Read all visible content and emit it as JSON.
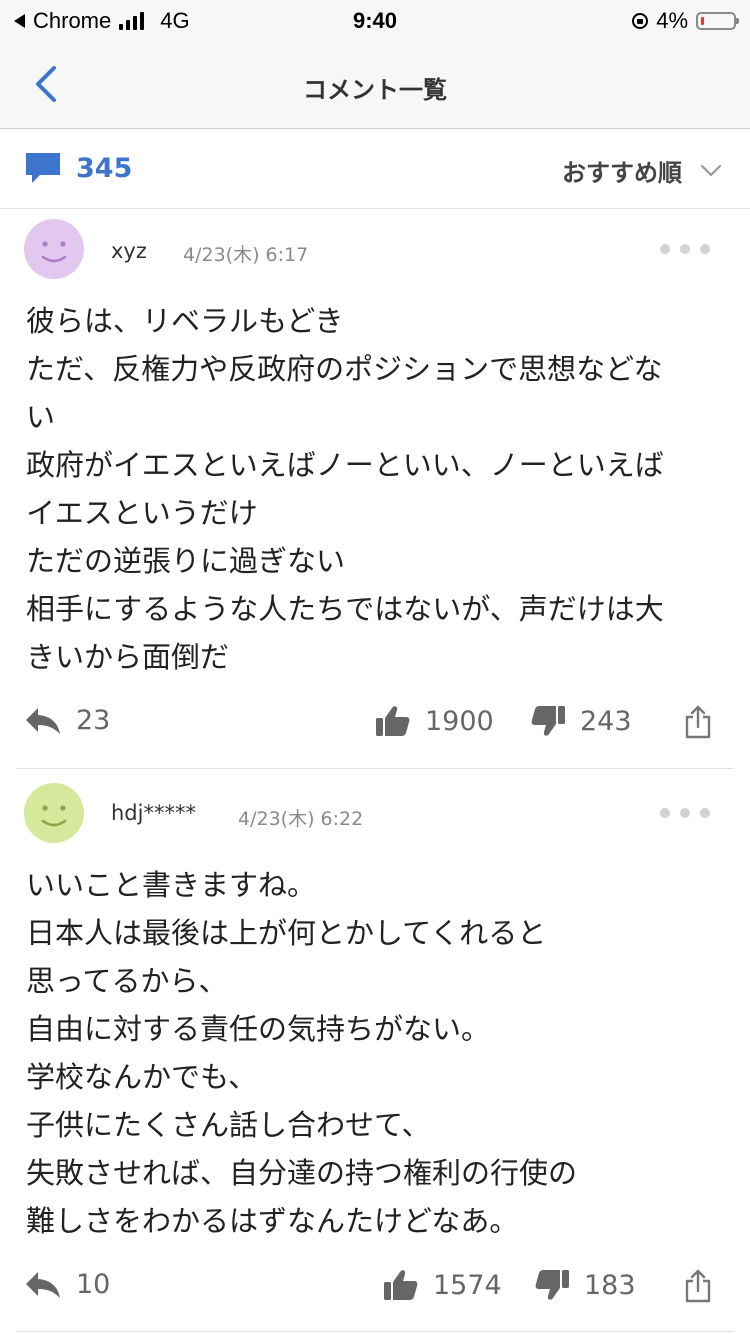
{
  "status_bar": {
    "app": "Chrome",
    "network": "4G",
    "time": "9:40",
    "battery": "4%"
  },
  "nav": {
    "title": "コメント一覧"
  },
  "summary": {
    "count": "345",
    "sort_label": "おすすめ順"
  },
  "colors": {
    "accent": "#3d74cc",
    "avatar_purple": "#e2c7ef",
    "avatar_green": "#d6e89b"
  },
  "comments": [
    {
      "user": "xyz",
      "date": "4/23(木) 6:17",
      "lines": [
        "彼らは、リベラルもどき",
        "ただ、反権力や反政府のポジションで思想などな",
        "い",
        "政府がイエスといえばノーといい、ノーといえば",
        "イエスというだけ",
        "ただの逆張りに過ぎない",
        "相手にするような人たちではないが、声だけは大",
        "きいから面倒だ"
      ],
      "replies": "23",
      "likes": "1900",
      "dislikes": "243"
    },
    {
      "user": "hdj*****",
      "date": "4/23(木) 6:22",
      "lines": [
        "いいこと書きますね。",
        "日本人は最後は上が何とかしてくれると",
        "思ってるから、",
        "自由に対する責任の気持ちがない。",
        "学校なんかでも、",
        "子供にたくさん話し合わせて、",
        "失敗させれば、自分達の持つ権利の行使の",
        "難しさをわかるはずなんたけどなあ。"
      ],
      "replies": "10",
      "likes": "1574",
      "dislikes": "183"
    }
  ]
}
